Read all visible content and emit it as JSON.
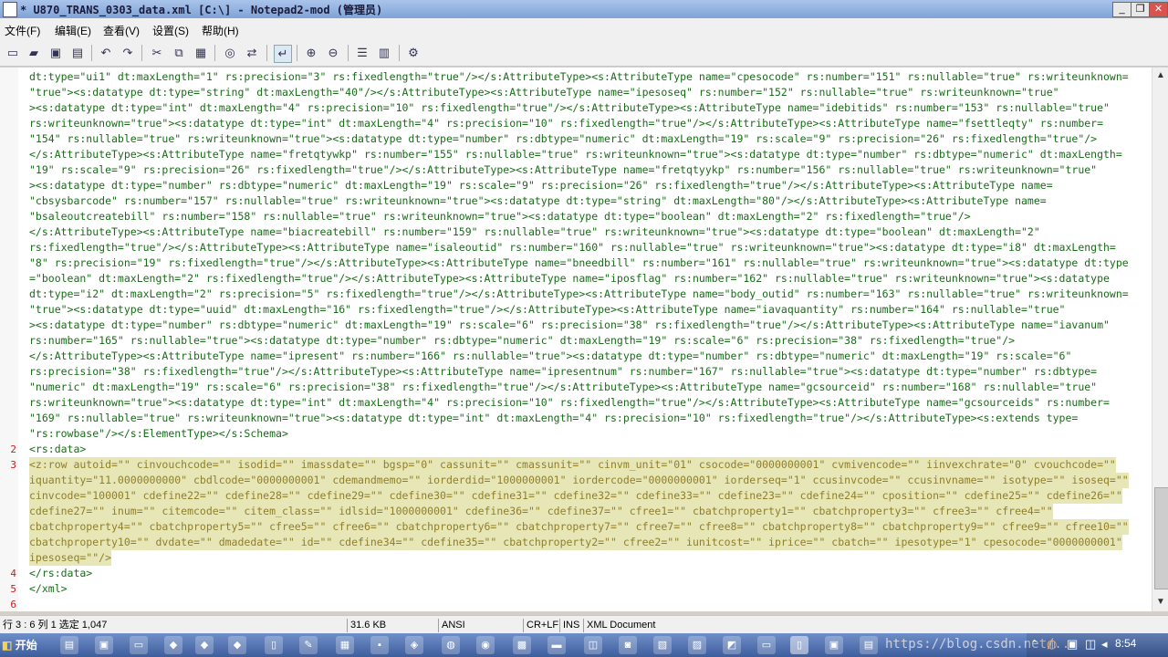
{
  "window": {
    "title": "* U870_TRANS_0303_data.xml [C:\\] - Notepad2-mod (管理员)",
    "controls": [
      "_",
      "❐",
      "✕"
    ]
  },
  "menu": [
    "文件(F)",
    "编辑(E)",
    "查看(V)",
    "设置(S)",
    "帮助(H)"
  ],
  "toolbar": [
    "new-icon",
    "open-icon",
    "save-icon",
    "saveas-icon",
    "undo-icon",
    "redo-icon",
    "cut-icon",
    "copy-icon",
    "paste-icon",
    "find-icon",
    "replace-icon",
    "wordwrap-icon",
    "zoomin-icon",
    "zoomout-icon",
    "linenumbers-icon",
    "selmargin-icon",
    "settings-icon"
  ],
  "editor": {
    "lines": [
      {
        "num": "",
        "text": "dt:type=\"ui1\" dt:maxLength=\"1\" rs:precision=\"3\" rs:fixedlength=\"true\"/></s:AttributeType><s:AttributeType name=\"cpesocode\" rs:number=\"151\" rs:nullable=\"true\" rs:writeunknown=",
        "hl": false
      },
      {
        "num": "",
        "text": "\"true\"><s:datatype dt:type=\"string\" dt:maxLength=\"40\"/></s:AttributeType><s:AttributeType name=\"ipesoseq\" rs:number=\"152\" rs:nullable=\"true\" rs:writeunknown=\"true\"",
        "hl": false
      },
      {
        "num": "",
        "text": "><s:datatype dt:type=\"int\" dt:maxLength=\"4\" rs:precision=\"10\" rs:fixedlength=\"true\"/></s:AttributeType><s:AttributeType name=\"idebitids\" rs:number=\"153\" rs:nullable=\"true\"",
        "hl": false
      },
      {
        "num": "",
        "text": "rs:writeunknown=\"true\"><s:datatype dt:type=\"int\" dt:maxLength=\"4\" rs:precision=\"10\" rs:fixedlength=\"true\"/></s:AttributeType><s:AttributeType name=\"fsettleqty\" rs:number=",
        "hl": false
      },
      {
        "num": "",
        "text": "\"154\" rs:nullable=\"true\" rs:writeunknown=\"true\"><s:datatype dt:type=\"number\" rs:dbtype=\"numeric\" dt:maxLength=\"19\" rs:scale=\"9\" rs:precision=\"26\" rs:fixedlength=\"true\"/>",
        "hl": false
      },
      {
        "num": "",
        "text": "</s:AttributeType><s:AttributeType name=\"fretqtywkp\" rs:number=\"155\" rs:nullable=\"true\" rs:writeunknown=\"true\"><s:datatype dt:type=\"number\" rs:dbtype=\"numeric\" dt:maxLength=",
        "hl": false
      },
      {
        "num": "",
        "text": "\"19\" rs:scale=\"9\" rs:precision=\"26\" rs:fixedlength=\"true\"/></s:AttributeType><s:AttributeType name=\"fretqtyykp\" rs:number=\"156\" rs:nullable=\"true\" rs:writeunknown=\"true\"",
        "hl": false
      },
      {
        "num": "",
        "text": "><s:datatype dt:type=\"number\" rs:dbtype=\"numeric\" dt:maxLength=\"19\" rs:scale=\"9\" rs:precision=\"26\" rs:fixedlength=\"true\"/></s:AttributeType><s:AttributeType name=",
        "hl": false
      },
      {
        "num": "",
        "text": "\"cbsysbarcode\" rs:number=\"157\" rs:nullable=\"true\" rs:writeunknown=\"true\"><s:datatype dt:type=\"string\" dt:maxLength=\"80\"/></s:AttributeType><s:AttributeType name=",
        "hl": false
      },
      {
        "num": "",
        "text": "\"bsaleoutcreatebill\" rs:number=\"158\" rs:nullable=\"true\" rs:writeunknown=\"true\"><s:datatype dt:type=\"boolean\" dt:maxLength=\"2\" rs:fixedlength=\"true\"/>",
        "hl": false
      },
      {
        "num": "",
        "text": "</s:AttributeType><s:AttributeType name=\"biacreatebill\" rs:number=\"159\" rs:nullable=\"true\" rs:writeunknown=\"true\"><s:datatype dt:type=\"boolean\" dt:maxLength=\"2\"",
        "hl": false
      },
      {
        "num": "",
        "text": "rs:fixedlength=\"true\"/></s:AttributeType><s:AttributeType name=\"isaleoutid\" rs:number=\"160\" rs:nullable=\"true\" rs:writeunknown=\"true\"><s:datatype dt:type=\"i8\" dt:maxLength=",
        "hl": false
      },
      {
        "num": "",
        "text": "\"8\" rs:precision=\"19\" rs:fixedlength=\"true\"/></s:AttributeType><s:AttributeType name=\"bneedbill\" rs:number=\"161\" rs:nullable=\"true\" rs:writeunknown=\"true\"><s:datatype dt:type",
        "hl": false
      },
      {
        "num": "",
        "text": "=\"boolean\" dt:maxLength=\"2\" rs:fixedlength=\"true\"/></s:AttributeType><s:AttributeType name=\"iposflag\" rs:number=\"162\" rs:nullable=\"true\" rs:writeunknown=\"true\"><s:datatype",
        "hl": false
      },
      {
        "num": "",
        "text": "dt:type=\"i2\" dt:maxLength=\"2\" rs:precision=\"5\" rs:fixedlength=\"true\"/></s:AttributeType><s:AttributeType name=\"body_outid\" rs:number=\"163\" rs:nullable=\"true\" rs:writeunknown=",
        "hl": false
      },
      {
        "num": "",
        "text": "\"true\"><s:datatype dt:type=\"uuid\" dt:maxLength=\"16\" rs:fixedlength=\"true\"/></s:AttributeType><s:AttributeType name=\"iavaquantity\" rs:number=\"164\" rs:nullable=\"true\"",
        "hl": false
      },
      {
        "num": "",
        "text": "><s:datatype dt:type=\"number\" rs:dbtype=\"numeric\" dt:maxLength=\"19\" rs:scale=\"6\" rs:precision=\"38\" rs:fixedlength=\"true\"/></s:AttributeType><s:AttributeType name=\"iavanum\"",
        "hl": false
      },
      {
        "num": "",
        "text": "rs:number=\"165\" rs:nullable=\"true\"><s:datatype dt:type=\"number\" rs:dbtype=\"numeric\" dt:maxLength=\"19\" rs:scale=\"6\" rs:precision=\"38\" rs:fixedlength=\"true\"/>",
        "hl": false
      },
      {
        "num": "",
        "text": "</s:AttributeType><s:AttributeType name=\"ipresent\" rs:number=\"166\" rs:nullable=\"true\"><s:datatype dt:type=\"number\" rs:dbtype=\"numeric\" dt:maxLength=\"19\" rs:scale=\"6\"",
        "hl": false
      },
      {
        "num": "",
        "text": "rs:precision=\"38\" rs:fixedlength=\"true\"/></s:AttributeType><s:AttributeType name=\"ipresentnum\" rs:number=\"167\" rs:nullable=\"true\"><s:datatype dt:type=\"number\" rs:dbtype=",
        "hl": false
      },
      {
        "num": "",
        "text": "\"numeric\" dt:maxLength=\"19\" rs:scale=\"6\" rs:precision=\"38\" rs:fixedlength=\"true\"/></s:AttributeType><s:AttributeType name=\"gcsourceid\" rs:number=\"168\" rs:nullable=\"true\"",
        "hl": false
      },
      {
        "num": "",
        "text": "rs:writeunknown=\"true\"><s:datatype dt:type=\"int\" dt:maxLength=\"4\" rs:precision=\"10\" rs:fixedlength=\"true\"/></s:AttributeType><s:AttributeType name=\"gcsourceids\" rs:number=",
        "hl": false
      },
      {
        "num": "",
        "text": "\"169\" rs:nullable=\"true\" rs:writeunknown=\"true\"><s:datatype dt:type=\"int\" dt:maxLength=\"4\" rs:precision=\"10\" rs:fixedlength=\"true\"/></s:AttributeType><s:extends type=",
        "hl": false
      },
      {
        "num": "",
        "text": "\"rs:rowbase\"/></s:ElementType></s:Schema>",
        "hl": false
      },
      {
        "num": "2",
        "text": "<rs:data>",
        "hl": false
      },
      {
        "num": "3",
        "text": "<z:row autoid=\"\" cinvouchcode=\"\" isodid=\"\" imassdate=\"\" bgsp=\"0\" cassunit=\"\" cmassunit=\"\" cinvm_unit=\"01\" csocode=\"0000000001\" cvmivencode=\"\" iinvexchrate=\"0\" cvouchcode=\"\"",
        "hl": true
      },
      {
        "num": "",
        "text": "iquantity=\"11.0000000000\" cbdlcode=\"0000000001\" cdemandmemo=\"\" iorderdid=\"1000000001\" iordercode=\"0000000001\" iorderseq=\"1\" ccusinvcode=\"\" ccusinvname=\"\" isotype=\"\" isoseq=\"\"",
        "hl": true
      },
      {
        "num": "",
        "text": "cinvcode=\"100001\" cdefine22=\"\" cdefine28=\"\" cdefine29=\"\" cdefine30=\"\" cdefine31=\"\" cdefine32=\"\" cdefine33=\"\" cdefine23=\"\" cdefine24=\"\" cposition=\"\" cdefine25=\"\" cdefine26=\"\"",
        "hl": true
      },
      {
        "num": "",
        "text": "cdefine27=\"\" inum=\"\" citemcode=\"\" citem_class=\"\" idlsid=\"1000000001\" cdefine36=\"\" cdefine37=\"\" cfree1=\"\" cbatchproperty1=\"\" cbatchproperty3=\"\" cfree3=\"\" cfree4=\"\"",
        "hl": true
      },
      {
        "num": "",
        "text": "cbatchproperty4=\"\" cbatchproperty5=\"\" cfree5=\"\" cfree6=\"\" cbatchproperty6=\"\" cbatchproperty7=\"\" cfree7=\"\" cfree8=\"\" cbatchproperty8=\"\" cbatchproperty9=\"\" cfree9=\"\" cfree10=\"\"",
        "hl": true
      },
      {
        "num": "",
        "text": "cbatchproperty10=\"\" dvdate=\"\" dmadedate=\"\" id=\"\" cdefine34=\"\" cdefine35=\"\" cbatchproperty2=\"\" cfree2=\"\" iunitcost=\"\" iprice=\"\" cbatch=\"\" ipesotype=\"1\" cpesocode=\"0000000001\"",
        "hl": true
      },
      {
        "num": "",
        "text": "ipesoseq=\"\"/>",
        "hl": true
      },
      {
        "num": "4",
        "text": "</rs:data>",
        "hl": false
      },
      {
        "num": "5",
        "text": "</xml>",
        "hl": false
      },
      {
        "num": "6",
        "text": "",
        "hl": false
      }
    ]
  },
  "status": {
    "position": "行 3 : 6   列 1   选定 1,047",
    "size": "31.6 KB",
    "encoding": "ANSI",
    "eol": "CR+LF",
    "ins": "INS",
    "scheme": "XML Document"
  },
  "taskbar": {
    "start": "开始",
    "clock": "8:54",
    "watermark": "https://blog.csdn.net/..."
  }
}
